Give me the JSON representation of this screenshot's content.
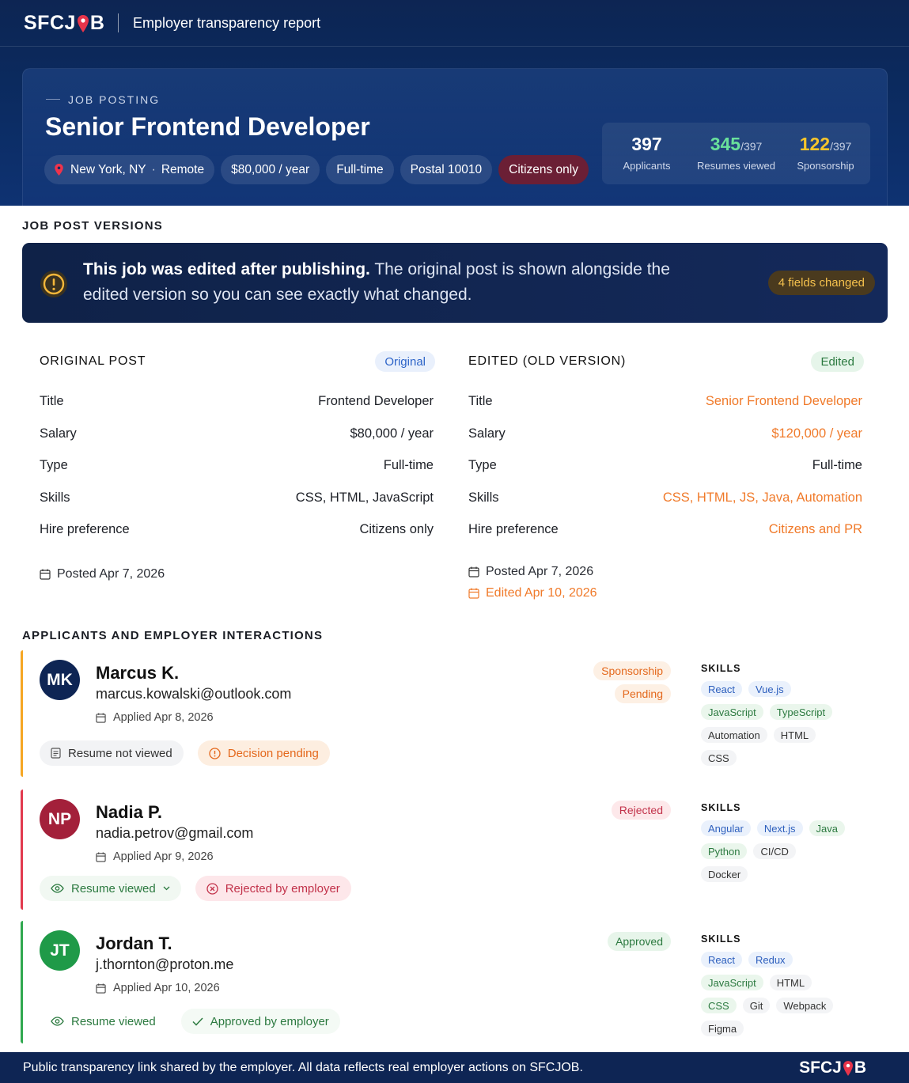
{
  "brand": {
    "name_left": "SFCJ",
    "name_right": "B",
    "report_title": "Employer transparency report"
  },
  "job": {
    "eyebrow": "JOB POSTING",
    "title": "Senior Frontend Developer",
    "location": "New York, NY",
    "remote": "Remote",
    "salary": "$80,000 / year",
    "type": "Full-time",
    "postal": "Postal 10010",
    "hire_pref": "Citizens only"
  },
  "stats": {
    "applicants": {
      "value": "397",
      "label": "Applicants"
    },
    "resumes": {
      "value": "345",
      "total": "/397",
      "label": "Resumes viewed"
    },
    "sponsorship": {
      "value": "122",
      "total": "/397",
      "label": "Sponsorship"
    }
  },
  "versions": {
    "heading": "JOB POST VERSIONS",
    "banner_bold": "This job was edited after publishing.",
    "banner_text": " The original post is shown alongside the edited version so you can see exactly what changed.",
    "fields_changed": "4 fields changed",
    "original": {
      "heading": "ORIGINAL POST",
      "pill": "Original",
      "rows": [
        {
          "k": "Title",
          "v": "Frontend Developer"
        },
        {
          "k": "Salary",
          "v": "$80,000 / year"
        },
        {
          "k": "Type",
          "v": "Full-time"
        },
        {
          "k": "Skills",
          "v": "CSS, HTML, JavaScript"
        },
        {
          "k": "Hire preference",
          "v": "Citizens only"
        }
      ],
      "posted": "Posted Apr 7, 2026"
    },
    "edited": {
      "heading": "EDITED (OLD VERSION)",
      "pill": "Edited",
      "rows": [
        {
          "k": "Title",
          "v": "Senior Frontend Developer"
        },
        {
          "k": "Salary",
          "v": "$120,000 / year"
        },
        {
          "k": "Type",
          "v": "Full-time"
        },
        {
          "k": "Skills",
          "v": "CSS, HTML, JS, Java, Automation"
        },
        {
          "k": "Hire preference",
          "v": "Citizens and PR"
        }
      ],
      "posted": "Posted Apr 7, 2026",
      "edited": "Edited Apr 10, 2026"
    }
  },
  "applicants": {
    "heading": "APPLICANTS AND EMPLOYER INTERACTIONS",
    "skills_heading": "SKILLS",
    "list": [
      {
        "initials": "MK",
        "name": "Marcus K.",
        "email": "marcus.kowalski@outlook.com",
        "applied": "Applied Apr 8, 2026",
        "resume": "Resume not viewed",
        "decision": "Decision pending",
        "tags": [
          "Sponsorship",
          "Pending"
        ],
        "skills": [
          "React",
          "Vue.js",
          "JavaScript",
          "TypeScript",
          "Automation",
          "HTML",
          "CSS"
        ]
      },
      {
        "initials": "NP",
        "name": "Nadia P.",
        "email": "nadia.petrov@gmail.com",
        "applied": "Applied Apr 9, 2026",
        "resume": "Resume viewed",
        "decision": "Rejected by employer",
        "tags": [
          "Rejected"
        ],
        "skills": [
          "Angular",
          "Next.js",
          "Java",
          "Python",
          "CI/CD",
          "Docker"
        ]
      },
      {
        "initials": "JT",
        "name": "Jordan T.",
        "email": "j.thornton@proton.me",
        "applied": "Applied Apr 10, 2026",
        "resume": "Resume viewed",
        "decision": "Approved by employer",
        "tags": [
          "Approved"
        ],
        "skills": [
          "React",
          "Redux",
          "JavaScript",
          "HTML",
          "CSS",
          "Git",
          "Webpack",
          "Figma"
        ]
      }
    ]
  },
  "footer": {
    "text": "Public transparency link shared by the employer. All data reflects real employer actions on SFCJOB."
  },
  "colors": {
    "navy": "#0e2554",
    "changed": "#f07a2a",
    "pending": "#f5a623",
    "rejected": "#c2324a",
    "approved": "#2fa84f"
  }
}
